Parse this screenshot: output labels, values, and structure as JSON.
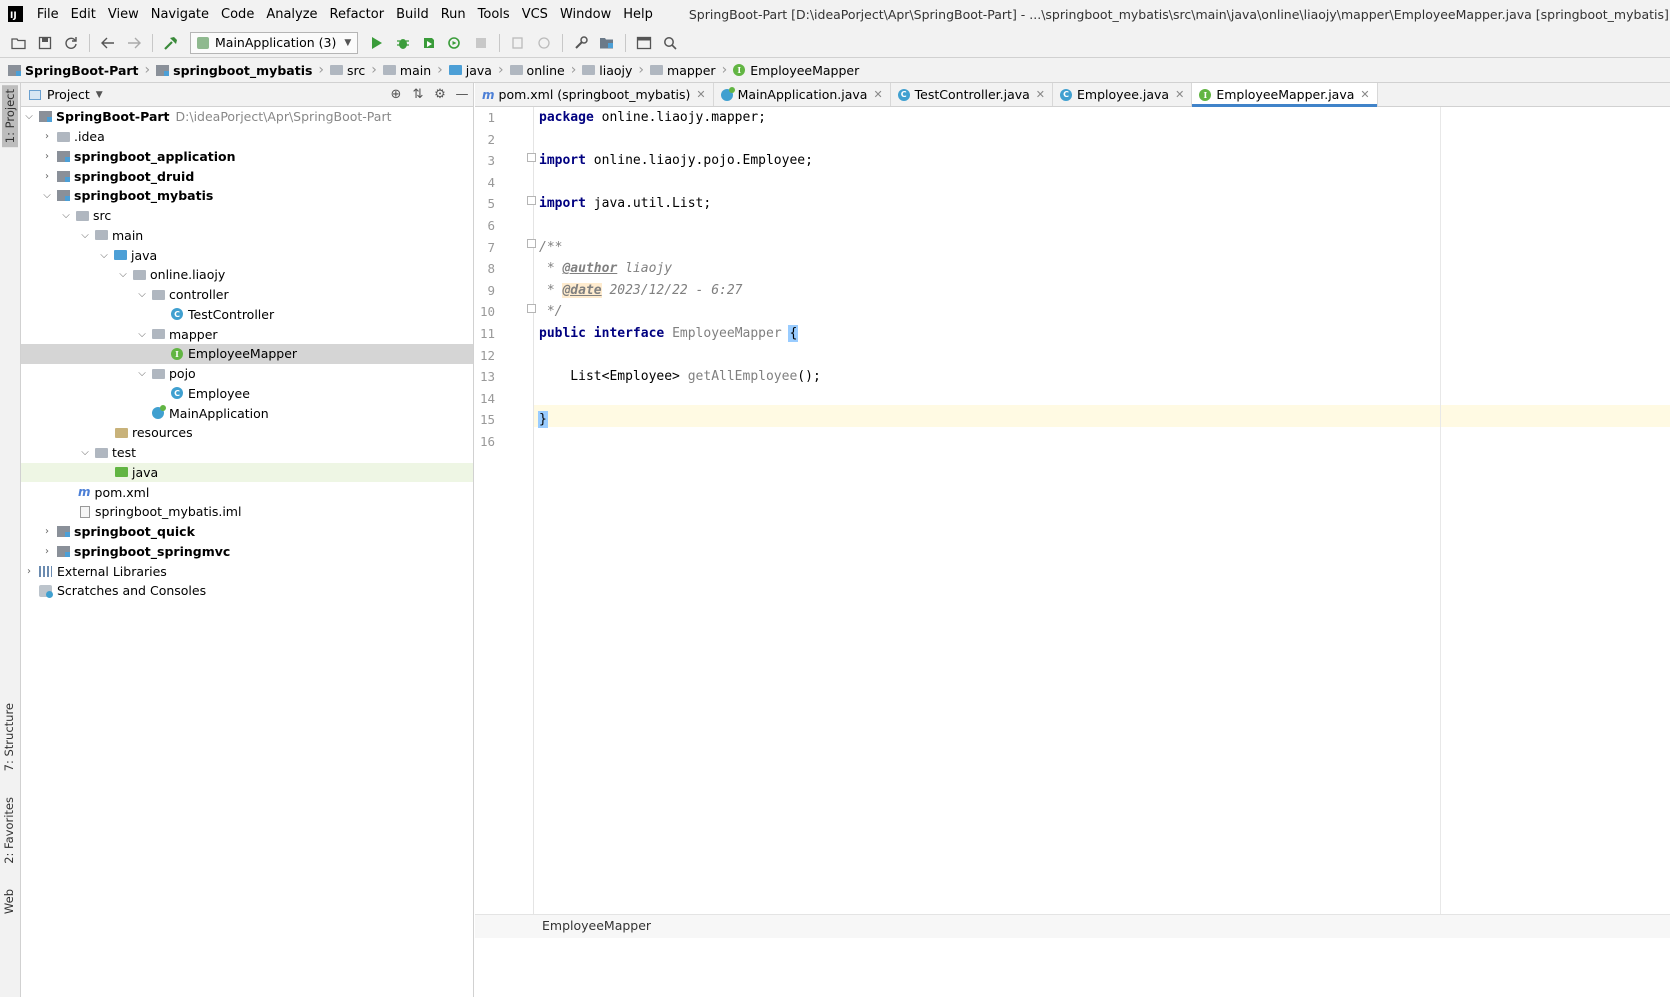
{
  "window_title": "SpringBoot-Part [D:\\ideaPorject\\Apr\\SpringBoot-Part] - ...\\springboot_mybatis\\src\\main\\java\\online\\liaojy\\mapper\\EmployeeMapper.java [springboot_mybatis] - IntelliJ IDEA",
  "menu": [
    "File",
    "Edit",
    "View",
    "Navigate",
    "Code",
    "Analyze",
    "Refactor",
    "Build",
    "Run",
    "Tools",
    "VCS",
    "Window",
    "Help"
  ],
  "toolbar": {
    "run_config": "MainApplication (3)"
  },
  "breadcrumb": [
    "SpringBoot-Part",
    "springboot_mybatis",
    "src",
    "main",
    "java",
    "online",
    "liaojy",
    "mapper",
    "EmployeeMapper"
  ],
  "left_strip": {
    "project": "1: Project",
    "structure": "7: Structure",
    "favorites": "2: Favorites",
    "web": "Web"
  },
  "project_panel": {
    "title": "Project",
    "tree": [
      {
        "label": "SpringBoot-Part",
        "path": "D:\\ideaPorject\\Apr\\SpringBoot-Part"
      },
      {
        "label": ".idea"
      },
      {
        "label": "springboot_application"
      },
      {
        "label": "springboot_druid"
      },
      {
        "label": "springboot_mybatis"
      },
      {
        "label": "src"
      },
      {
        "label": "main"
      },
      {
        "label": "java"
      },
      {
        "label": "online.liaojy"
      },
      {
        "label": "controller"
      },
      {
        "label": "TestController"
      },
      {
        "label": "mapper"
      },
      {
        "label": "EmployeeMapper"
      },
      {
        "label": "pojo"
      },
      {
        "label": "Employee"
      },
      {
        "label": "MainApplication"
      },
      {
        "label": "resources"
      },
      {
        "label": "test"
      },
      {
        "label": "java"
      },
      {
        "label": "pom.xml"
      },
      {
        "label": "springboot_mybatis.iml"
      },
      {
        "label": "springboot_quick"
      },
      {
        "label": "springboot_springmvc"
      },
      {
        "label": "External Libraries"
      },
      {
        "label": "Scratches and Consoles"
      }
    ]
  },
  "editor_tabs": [
    {
      "label": "pom.xml (springboot_mybatis)",
      "icon": "maven-icon"
    },
    {
      "label": "MainApplication.java",
      "icon": "spring-class-icon"
    },
    {
      "label": "TestController.java",
      "icon": "class-icon"
    },
    {
      "label": "Employee.java",
      "icon": "class-icon"
    },
    {
      "label": "EmployeeMapper.java",
      "icon": "interface-icon",
      "active": true
    }
  ],
  "line_numbers": [
    "1",
    "2",
    "3",
    "4",
    "5",
    "6",
    "7",
    "8",
    "9",
    "10",
    "11",
    "12",
    "13",
    "14",
    "15",
    "16"
  ],
  "code": {
    "l1_kw": "package",
    "l1_rest": " online.liaojy.mapper;",
    "l3_kw": "import",
    "l3_rest": " online.liaojy.pojo.Employee;",
    "l5_kw": "import",
    "l5_rest": " java.util.List;",
    "l7": "/**",
    "l8_pre": " * ",
    "l8_tag": "@author",
    "l8_val": " liaojy",
    "l9_pre": " * ",
    "l9_tag": "@date",
    "l9_val": " 2023/12/22 - 6:27",
    "l10": " */",
    "l11_kw1": "public",
    "l11_kw2": "interface",
    "l11_name": "EmployeeMapper",
    "l11_brace": "{",
    "l13_type": "    List<Employee> ",
    "l13_method": "getAllEmployee",
    "l13_rest": "();",
    "l15_brace": "}"
  },
  "editor_breadcrumb": "EmployeeMapper",
  "colors": {
    "keyword": "#000080",
    "comment": "#808080",
    "selection": "#d5d5d5",
    "current_line": "#fffae3",
    "tab_underline": "#4083c9"
  }
}
